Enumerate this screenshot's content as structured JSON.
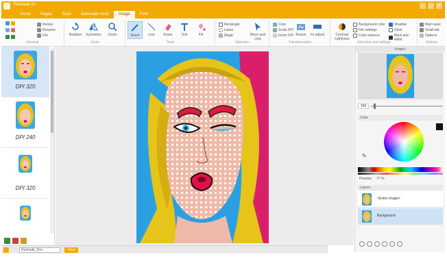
{
  "titlebar": {
    "title": "Reshade IU",
    "controls": [
      "–",
      "□",
      "×"
    ]
  },
  "tabs": [
    {
      "label": "Home"
    },
    {
      "label": "Pages"
    },
    {
      "label": "Tools"
    },
    {
      "label": "Automatic tools"
    },
    {
      "label": "Image"
    },
    {
      "label": "Font"
    }
  ],
  "ribbon": {
    "groups": [
      {
        "label": "General"
      },
      {
        "label": "Zoom"
      },
      {
        "label": "Tools"
      },
      {
        "label": "Selection"
      },
      {
        "label": "Transformation"
      },
      {
        "label": "Selection and settings"
      },
      {
        "label": "Options"
      }
    ],
    "buttons": {
      "rotation": "Rotation",
      "symmetry": "Symmetry",
      "zoom": "Zoom",
      "brush": "Brush",
      "line": "Line",
      "erase": "Erase",
      "text": "Text",
      "fill": "Fill",
      "move_crop": "Move and crop",
      "resize": "Resize",
      "fx_adjust": "Fx adjust",
      "contrast": "Contrast Lightness"
    },
    "small": {
      "resize": "Resize",
      "rename": "Rename",
      "file": "File",
      "rectangle": "Rectangle",
      "lasso": "Lasso",
      "magic": "Magic",
      "crop": "Crop",
      "scale_dpi": "Scale DPI",
      "invert_dpi": "Invert DPI",
      "bg_color": "Background color",
      "file_settings": "File settings",
      "color_balance": "Color balance",
      "shadow": "Shadow",
      "glow": "Glow",
      "back_and_white": "Back and white",
      "main_layer": "Main layer",
      "small_tab": "Small tab",
      "options": "Options"
    }
  },
  "thumbnails": [
    {
      "label": "DPI 320",
      "active": true
    },
    {
      "label": "DPI 240",
      "active": false
    },
    {
      "label": "DPI 320",
      "active": false
    },
    {
      "label": "",
      "active": false
    }
  ],
  "right_panel": {
    "header": "Images",
    "zoom_value": "100",
    "color_section": "Color",
    "preview_label": "Preview",
    "preview_value": "77 %",
    "layers_section": "Layers",
    "layers": [
      {
        "name": "<Entire image>",
        "selected": false
      },
      {
        "name": "Background",
        "selected": true
      }
    ]
  },
  "statusbar": {
    "field": "Reshade_Doc",
    "tag": "View"
  },
  "colors": {
    "accent": "#f2a900",
    "canvas_bg": "#ececec",
    "selection": "#cfe2f5"
  }
}
